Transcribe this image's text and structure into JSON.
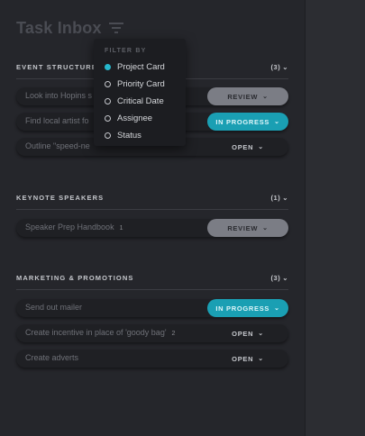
{
  "header": {
    "title": "Task Inbox"
  },
  "filter_menu": {
    "title": "FILTER BY",
    "options": [
      "Project Card",
      "Priority Card",
      "Critical Date",
      "Assignee",
      "Status"
    ],
    "selected": "Project Card"
  },
  "sections": [
    {
      "name": "EVENT STRUCTURE",
      "count": "(3)",
      "tasks": [
        {
          "label": "Look into Hopins s",
          "status": "REVIEW"
        },
        {
          "label": "Find local artist fo",
          "status": "IN PROGRESS"
        },
        {
          "label": "Outline \"speed-ne",
          "status": "OPEN"
        }
      ]
    },
    {
      "name": "KEYNOTE SPEAKERS",
      "count": "(1)",
      "tasks": [
        {
          "label": "Speaker Prep Handbook",
          "badge": "1",
          "status": "REVIEW"
        }
      ]
    },
    {
      "name": "MARKETING & PROMOTIONS",
      "count": "(3)",
      "tasks": [
        {
          "label": "Send out mailer",
          "status": "IN PROGRESS"
        },
        {
          "label": "Create incentive in place of 'goody bag'",
          "badge": "2",
          "status": "OPEN"
        },
        {
          "label": "Create adverts",
          "status": "OPEN"
        }
      ]
    }
  ],
  "colors": {
    "accent": "#1a9fb3",
    "review": "#7b7d85",
    "panel": "#25262b"
  }
}
